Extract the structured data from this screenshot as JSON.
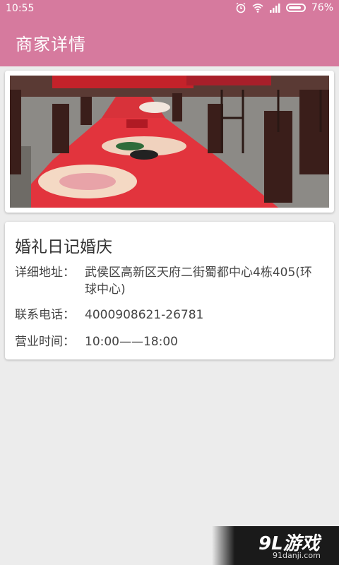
{
  "status_bar": {
    "time": "10:55",
    "battery_percent": "76%",
    "icons": [
      "alarm-icon",
      "wifi-icon",
      "signal-icon",
      "battery-icon"
    ]
  },
  "app_bar": {
    "title": "商家详情"
  },
  "merchant": {
    "name": "婚礼日记婚庆",
    "address_label": "详细地址：",
    "address_value": "武侯区高新区天府二街蜀都中心4栋405(环球中心)",
    "phone_label": "联系电话：",
    "phone_value": "4000908621-26781",
    "hours_label": "营业时间：",
    "hours_value": "10:00——18:00"
  },
  "watermark": {
    "logo": "9L游戏",
    "site": "91danji.com"
  },
  "colors": {
    "accent": "#d67a9e",
    "background": "#ececec",
    "card": "#ffffff"
  }
}
